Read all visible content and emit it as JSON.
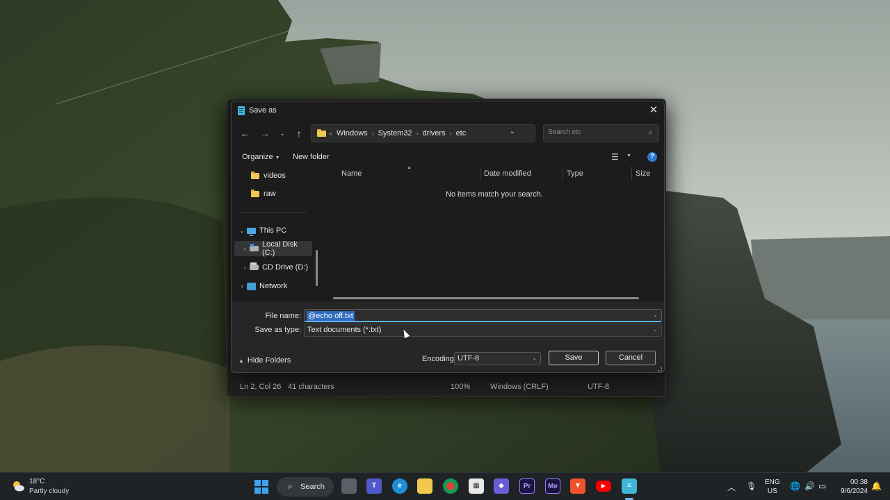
{
  "dialog": {
    "title": "Save as",
    "breadcrumbs": [
      "Windows",
      "System32",
      "drivers",
      "etc"
    ],
    "breadcrumb_overflow": "«",
    "search_placeholder": "Search etc",
    "toolbar": {
      "organize": "Organize",
      "new_folder": "New folder"
    },
    "nav_items": [
      {
        "label": "videos",
        "icon": "folder-icon"
      },
      {
        "label": "raw",
        "icon": "folder-icon"
      },
      {
        "label": "This PC",
        "icon": "pc-icon"
      },
      {
        "label": "Local Disk (C:)",
        "icon": "disk-icon",
        "selected": true
      },
      {
        "label": "CD Drive (D:)",
        "icon": "cd-drive-icon"
      },
      {
        "label": "Network",
        "icon": "network-icon"
      }
    ],
    "columns": [
      "Name",
      "Date modified",
      "Type",
      "Size"
    ],
    "empty_message": "No items match your search.",
    "file_name_label": "File name:",
    "file_name_value": "@echo off.txt",
    "save_type_label": "Save as type:",
    "save_type_value": "Text documents (*.txt)",
    "hide_folders": "Hide Folders",
    "encoding_label": "Encoding:",
    "encoding_value": "UTF-8",
    "save_button": "Save",
    "cancel_button": "Cancel"
  },
  "notepad_status": {
    "position": "Ln 2, Col 26",
    "characters": "41 characters",
    "zoom": "100%",
    "line_ending": "Windows (CRLF)",
    "encoding": "UTF-8"
  },
  "taskbar": {
    "weather_temp": "18°C",
    "weather_desc": "Partly cloudy",
    "search_label": "Search",
    "apps": [
      "task-view",
      "teams",
      "edge",
      "file-explorer",
      "chrome",
      "store",
      "copilot",
      "premiere",
      "media-encoder",
      "brave",
      "youtube",
      "notepad"
    ],
    "lang_1": "ENG",
    "lang_2": "US",
    "time": "00:38",
    "date": "9/6/2024"
  },
  "colors": {
    "accent": "#5fb2f2",
    "selection": "#2f6dbf",
    "dialog_bg": "#1c1c1c"
  }
}
